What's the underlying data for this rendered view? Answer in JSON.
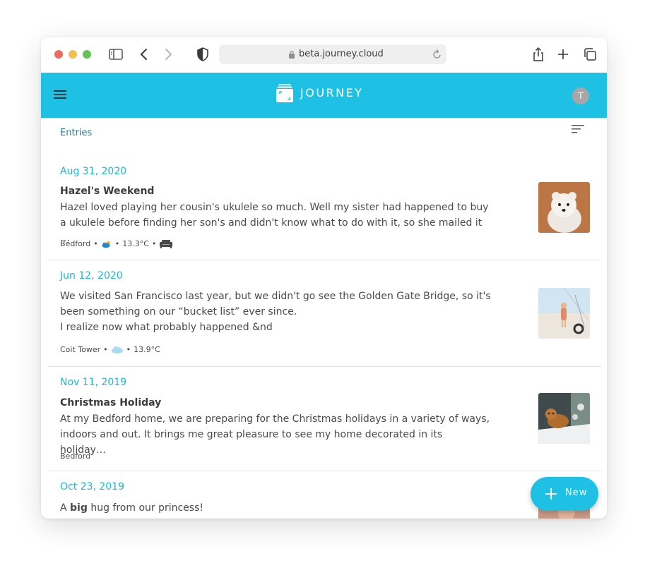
{
  "browser": {
    "url": "beta.journey.cloud"
  },
  "app": {
    "brand": "JOURNEY",
    "avatar_initial": "T",
    "entries_label": "Entries",
    "new_button_label": "New"
  },
  "entries": [
    {
      "date": "Aug 31, 2020",
      "title": "Hazel's Weekend",
      "body": [
        "Hazel loved playing her cousin's ukulele so much. Well my sister had happened to buy",
        "a ukulele before finding her son's and didn't know what to do with it, so she mailed it …"
      ],
      "location": "Bedford",
      "temperature": "13.3°C",
      "weather_icon": "partly-cloudy-icon",
      "activity_icon": "couch-icon"
    },
    {
      "date": "Jun 12, 2020",
      "title": "",
      "body": [
        "We visited San Francisco last year, but we didn't go see the Golden Gate Bridge, so it's",
        "been something on our “bucket list” ever since.",
        "I realize now what probably happened &nd"
      ],
      "location": "Coit Tower",
      "temperature": "13.9°C",
      "weather_icon": "cloud-icon"
    },
    {
      "date": "Nov 11, 2019",
      "title": "Christmas Holiday",
      "body": [
        "At my Bedford home, we are preparing for the Christmas holidays in a variety of ways,",
        "indoors and out. It brings me great pleasure to see my home decorated in its holiday…"
      ],
      "location": "Bedford"
    },
    {
      "date": "Oct 23, 2019",
      "body_prefix": "A ",
      "body_bold": "big",
      "body_suffix": " hug from our princess!"
    }
  ],
  "colors": {
    "accent": "#1ec1e4",
    "date_text": "#1ab8dc",
    "entries_label": "#1b7f97"
  }
}
